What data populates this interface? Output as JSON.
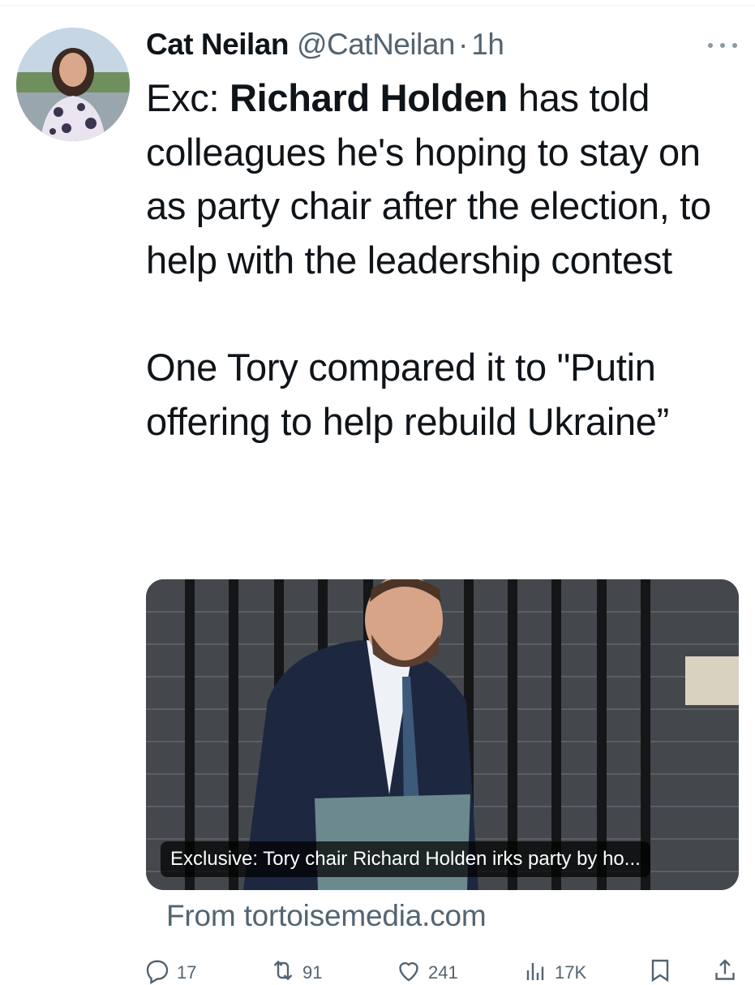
{
  "author": {
    "name": "Cat Neilan",
    "handle": "@CatNeilan",
    "separator": "·",
    "time": "1h"
  },
  "tweet": {
    "line_prefix": "Exc: ",
    "bold_name": "Richard Holden",
    "line_rest": " has told colleagues he's hoping to stay on as party chair after the election, to help with the leadership contest",
    "paragraph2": "One Tory compared it to \"Putin offering to help rebuild Ukraine”"
  },
  "card": {
    "caption": "Exclusive: Tory chair Richard Holden irks party by ho...",
    "source": "From tortoisemedia.com"
  },
  "actions": {
    "replies": "17",
    "reposts": "91",
    "likes": "241",
    "views": "17K"
  },
  "icons": {
    "more": "more-icon",
    "reply": "reply-icon",
    "repost": "repost-icon",
    "like": "heart-icon",
    "views": "views-icon",
    "bookmark": "bookmark-icon",
    "share": "share-icon"
  },
  "colors": {
    "text": "#0f1419",
    "secondary": "#536471"
  }
}
